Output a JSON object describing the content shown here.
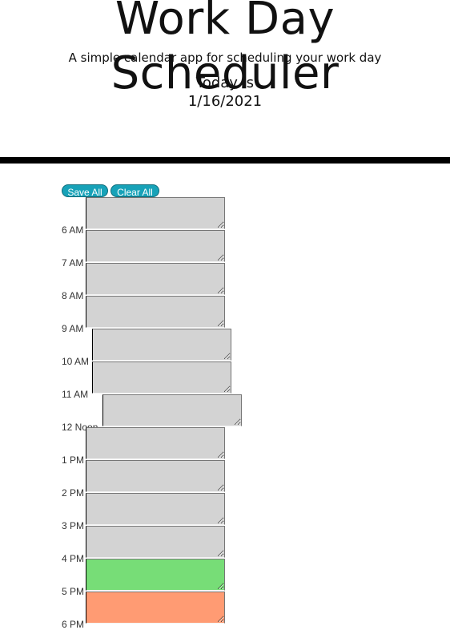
{
  "header": {
    "title": "Work Day Scheduler",
    "subtitle": "A simple calendar app for scheduling your work day",
    "today_label": "Today is",
    "today_date": "1/16/2021"
  },
  "actions": {
    "save_all": "Save All",
    "clear_all": "Clear All"
  },
  "schedule": {
    "hours": [
      {
        "label": "6 AM",
        "status": "past"
      },
      {
        "label": "7 AM",
        "status": "past"
      },
      {
        "label": "8 AM",
        "status": "past"
      },
      {
        "label": "9 AM",
        "status": "past"
      },
      {
        "label": "10 AM",
        "status": "past"
      },
      {
        "label": "11 AM",
        "status": "past"
      },
      {
        "label": "12 Noon",
        "status": "past"
      },
      {
        "label": "1 PM",
        "status": "past"
      },
      {
        "label": "2 PM",
        "status": "past"
      },
      {
        "label": "3 PM",
        "status": "past"
      },
      {
        "label": "4 PM",
        "status": "past"
      },
      {
        "label": "5 PM",
        "status": "present"
      },
      {
        "label": "6 PM",
        "status": "future"
      }
    ]
  },
  "colors": {
    "past": "#d3d3d3",
    "present": "#77dd77",
    "future": "#ff9b73",
    "button": "#17a2b8"
  }
}
